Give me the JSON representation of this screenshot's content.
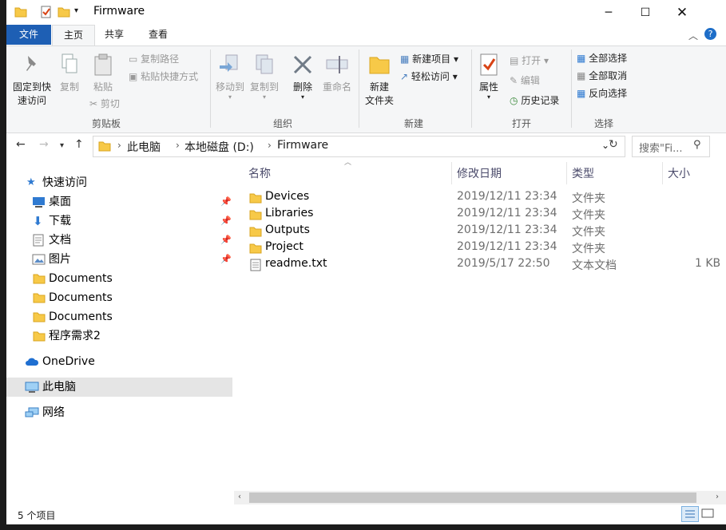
{
  "window": {
    "title": "Firmware"
  },
  "tabs": {
    "file": "文件",
    "home": "主页",
    "share": "共享",
    "view": "查看"
  },
  "ribbon": {
    "clipboard": {
      "pin": [
        "固定到快",
        "速访问"
      ],
      "copy": "复制",
      "paste": "粘贴",
      "copy_path": "复制路径",
      "paste_shortcut": "粘贴快捷方式",
      "cut": "剪切",
      "group": "剪贴板"
    },
    "organize": {
      "move_to": "移动到",
      "copy_to": "复制到",
      "delete": "删除",
      "rename": "重命名",
      "group": "组织"
    },
    "new": {
      "new_folder": [
        "新建",
        "文件夹"
      ],
      "new_item": "新建项目",
      "easy_access": "轻松访问",
      "group": "新建"
    },
    "open": {
      "properties": "属性",
      "open": "打开",
      "edit": "编辑",
      "history": "历史记录",
      "group": "打开"
    },
    "select": {
      "select_all": "全部选择",
      "select_none": "全部取消",
      "invert": "反向选择",
      "group": "选择"
    }
  },
  "address": {
    "crumbs": [
      "此电脑",
      "本地磁盘 (D:)",
      "Firmware"
    ],
    "search_placeholder": "搜索\"Fi..."
  },
  "nav": {
    "quick_access": "快速访问",
    "items": [
      "桌面",
      "下载",
      "文档",
      "图片",
      "Documents",
      "Documents",
      "Documents",
      "程序需求2"
    ],
    "onedrive": "OneDrive",
    "this_pc": "此电脑",
    "network": "网络"
  },
  "columns": {
    "name": "名称",
    "modified": "修改日期",
    "type": "类型",
    "size": "大小"
  },
  "files": [
    {
      "name": "Devices",
      "modified": "2019/12/11 23:34",
      "type": "文件夹",
      "size": ""
    },
    {
      "name": "Libraries",
      "modified": "2019/12/11 23:34",
      "type": "文件夹",
      "size": ""
    },
    {
      "name": "Outputs",
      "modified": "2019/12/11 23:34",
      "type": "文件夹",
      "size": ""
    },
    {
      "name": "Project",
      "modified": "2019/12/11 23:34",
      "type": "文件夹",
      "size": ""
    },
    {
      "name": "readme.txt",
      "modified": "2019/5/17 22:50",
      "type": "文本文档",
      "size": "1 KB"
    }
  ],
  "status": {
    "count": "5 个项目"
  },
  "colors": {
    "accent": "#1e5fb4",
    "folder": "#f7c948",
    "selected": "#e5e5e5"
  }
}
